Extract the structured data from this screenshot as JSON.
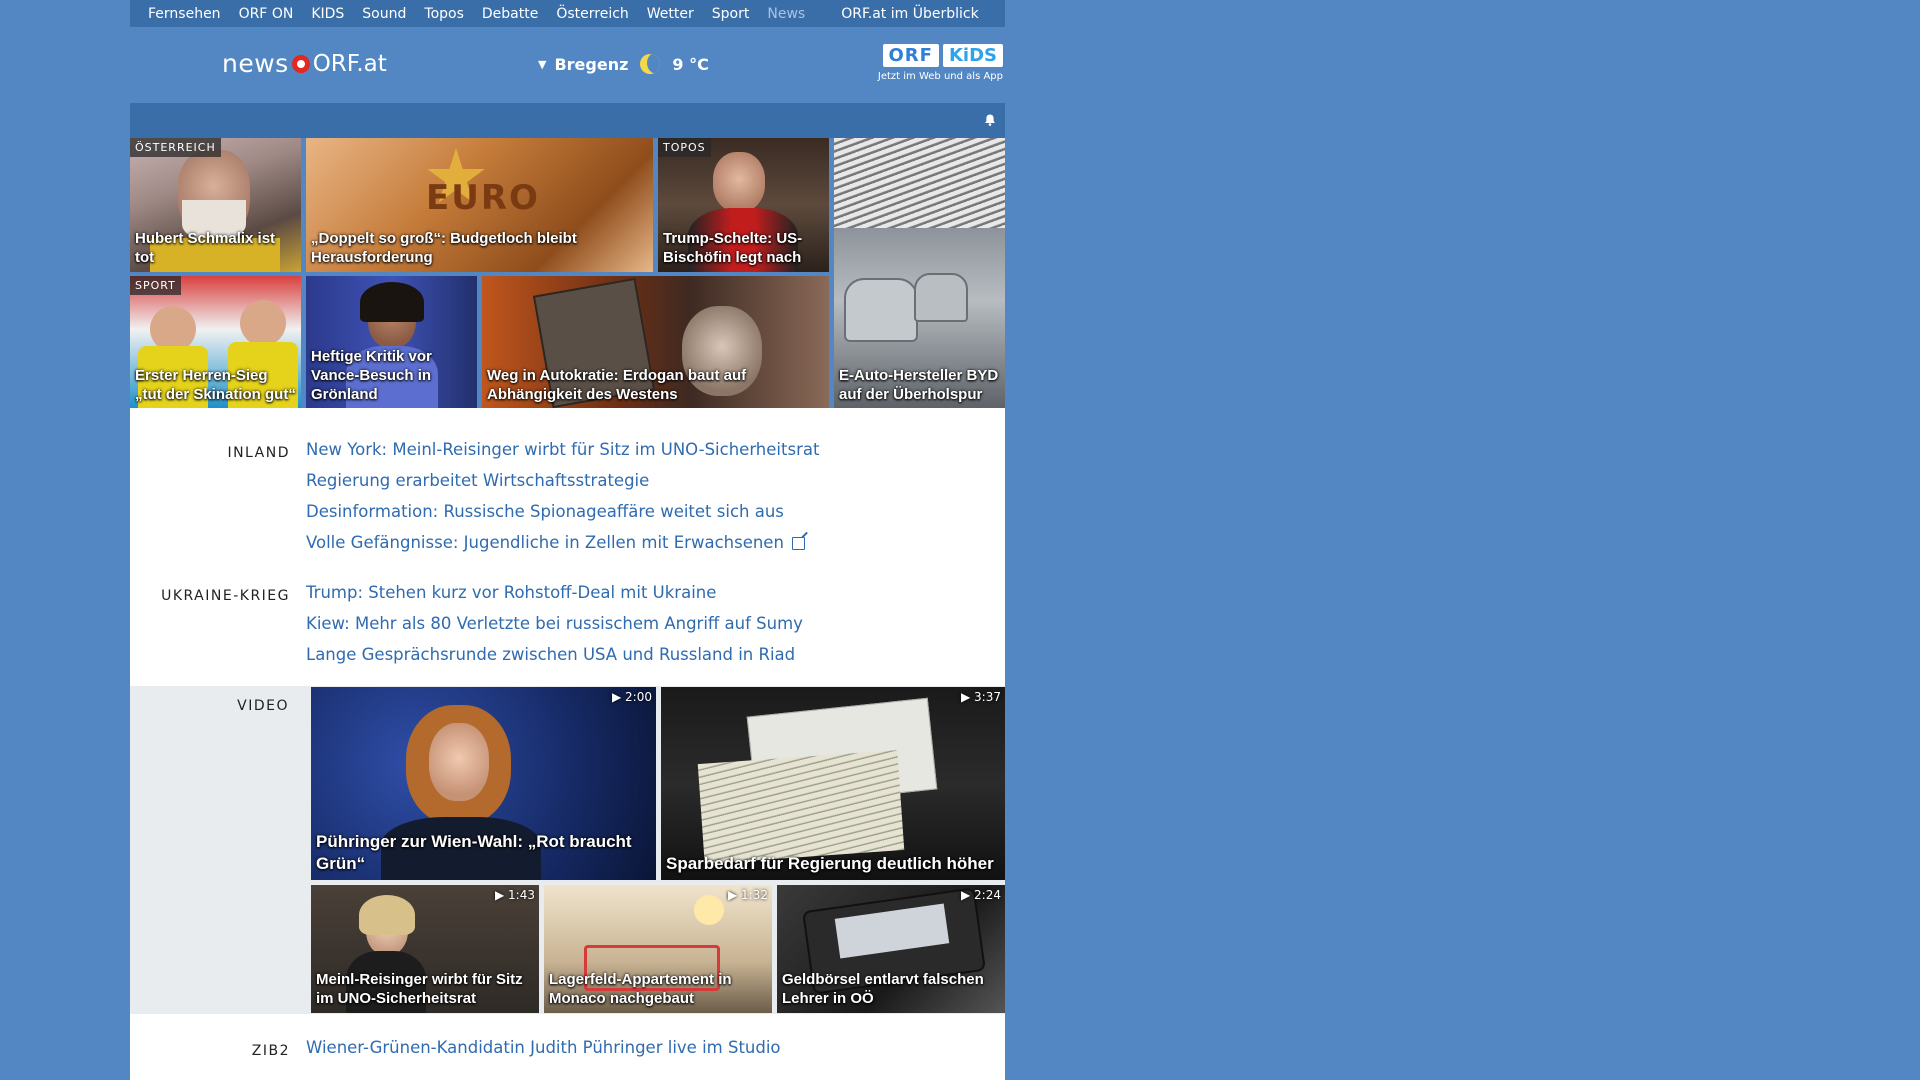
{
  "topnav": {
    "items": [
      "Fernsehen",
      "ORF ON",
      "KIDS",
      "Sound",
      "Topos",
      "Debatte",
      "Österreich",
      "Wetter",
      "Sport",
      "News"
    ],
    "active": "News",
    "overview": "ORF.at im Überblick"
  },
  "header": {
    "logo_news": "news",
    "logo_orf": "ORF.at",
    "weather_city": "Bregenz",
    "weather_temp": "9 °C",
    "kids_badge_orf": "ORF",
    "kids_badge_kids": "KiDS",
    "kids_tagline": "Jetzt im Web und als App"
  },
  "teasers": [
    {
      "label": "ÖSTERREICH",
      "caption": "Hubert Schmalix ist tot"
    },
    {
      "label": "",
      "caption": "„Doppelt so groß“: Budgetloch bleibt Herausforderung"
    },
    {
      "label": "TOPOS",
      "caption": "Trump-Schelte: US-Bischöfin legt nach"
    },
    {
      "label": "",
      "caption": "E-Auto-Hersteller BYD auf der Überholspur"
    },
    {
      "label": "SPORT",
      "caption": "Erster Herren-Sieg „tut der Skination gut“"
    },
    {
      "label": "",
      "caption": "Heftige Kritik vor Vance-Besuch in Grönland"
    },
    {
      "label": "",
      "caption": "Weg in Autokratie: Erdogan baut auf Abhängigkeit des Westens"
    }
  ],
  "sections": {
    "inland": {
      "title": "INLAND",
      "links": [
        "New York: Meinl-Reisinger wirbt für Sitz im UNO-Sicherheitsrat",
        "Regierung erarbeitet Wirtschaftsstrategie",
        "Desinformation: Russische Spionageaffäre weitet sich aus",
        "Volle Gefängnisse: Jugendliche in Zellen mit Erwachsenen"
      ]
    },
    "ukraine": {
      "title": "UKRAINE-KRIEG",
      "links": [
        "Trump: Stehen kurz vor Rohstoff-Deal mit Ukraine",
        "Kiew: Mehr als 80 Verletzte bei russischem Angriff auf Sumy",
        "Lange Gesprächsrunde zwischen USA und Russland in Riad"
      ]
    },
    "video": {
      "title": "VIDEO",
      "items": [
        {
          "duration": "2:00",
          "caption": "Pühringer zur Wien-Wahl: „Rot braucht Grün“"
        },
        {
          "duration": "3:37",
          "caption": "Sparbedarf für Regierung deutlich höher"
        },
        {
          "duration": "1:43",
          "caption": "Meinl-Reisinger wirbt für Sitz im UNO-Sicherheitsrat"
        },
        {
          "duration": "1:32",
          "caption": "Lagerfeld-Appartement in Monaco nachgebaut"
        },
        {
          "duration": "2:24",
          "caption": "Geldbörsel entlarvt falschen Lehrer in OÖ"
        }
      ]
    },
    "zib2": {
      "title": "ZIB2",
      "links": [
        "Wiener-Grünen-Kandidatin Judith Pühringer live im Studio"
      ]
    }
  }
}
